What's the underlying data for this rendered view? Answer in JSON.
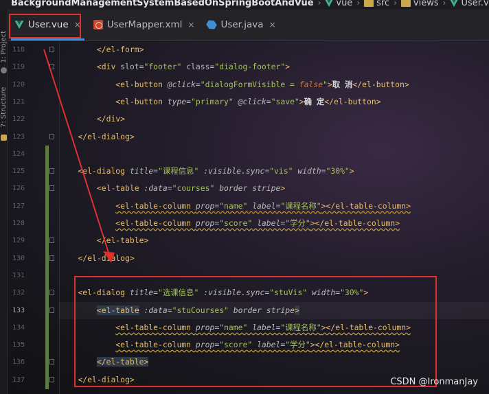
{
  "breadcrumb": {
    "project": "BackgroundManagementSystemBasedOnSpringBootAndVue",
    "items": [
      "vue",
      "src",
      "views",
      "User.vue"
    ]
  },
  "tabs": [
    {
      "label": "User.vue",
      "active": true,
      "icon": "vue-icon"
    },
    {
      "label": "UserMapper.xml",
      "active": false,
      "icon": "xml-mapper-icon"
    },
    {
      "label": "User.java",
      "active": false,
      "icon": "java-class-icon"
    }
  ],
  "close_glyph": "×",
  "toolstrip": {
    "project_label": "1: Project",
    "structure_label": "7: Structure"
  },
  "lines": [
    {
      "num": "118",
      "tokens": [
        [
          "p",
          "        "
        ],
        [
          "t",
          "</el-form>"
        ]
      ]
    },
    {
      "num": "119",
      "tokens": [
        [
          "p",
          "        "
        ],
        [
          "t",
          "<div "
        ],
        [
          "ak",
          "slot"
        ],
        [
          "p",
          "="
        ],
        [
          "s",
          "\"footer\""
        ],
        [
          "p",
          " "
        ],
        [
          "ak",
          "class"
        ],
        [
          "p",
          "="
        ],
        [
          "s",
          "\"dialog-footer\""
        ],
        [
          "t",
          ">"
        ]
      ]
    },
    {
      "num": "120",
      "tokens": [
        [
          "p",
          "            "
        ],
        [
          "t",
          "<el-button "
        ],
        [
          "at",
          "@click"
        ],
        [
          "p",
          "="
        ],
        [
          "s",
          "\"dialogFormVisible = "
        ],
        [
          "kw",
          "false"
        ],
        [
          "s",
          "\""
        ],
        [
          "t",
          ">"
        ],
        [
          "cn",
          "取 消"
        ],
        [
          "t",
          "</el-button>"
        ]
      ]
    },
    {
      "num": "121",
      "tokens": [
        [
          "p",
          "            "
        ],
        [
          "t",
          "<el-button "
        ],
        [
          "at",
          "type"
        ],
        [
          "p",
          "="
        ],
        [
          "s",
          "\"primary\""
        ],
        [
          "p",
          " "
        ],
        [
          "at",
          "@click"
        ],
        [
          "p",
          "="
        ],
        [
          "s",
          "\"save\""
        ],
        [
          "t",
          ">"
        ],
        [
          "cn",
          "确 定"
        ],
        [
          "t",
          "</el-button>"
        ]
      ]
    },
    {
      "num": "122",
      "tokens": [
        [
          "p",
          "        "
        ],
        [
          "t",
          "</div>"
        ]
      ]
    },
    {
      "num": "123",
      "tokens": [
        [
          "p",
          "    "
        ],
        [
          "t",
          "</el-dialog>"
        ]
      ]
    },
    {
      "num": "124",
      "tokens": []
    },
    {
      "num": "125",
      "tokens": [
        [
          "p",
          "    "
        ],
        [
          "t",
          "<el-dialog "
        ],
        [
          "at",
          "title"
        ],
        [
          "p",
          "="
        ],
        [
          "s",
          "\"课程信息\""
        ],
        [
          "p",
          " "
        ],
        [
          "at",
          ":visible.sync"
        ],
        [
          "p",
          "="
        ],
        [
          "s",
          "\"vis\""
        ],
        [
          "p",
          " "
        ],
        [
          "at",
          "width"
        ],
        [
          "p",
          "="
        ],
        [
          "s",
          "\"30%\""
        ],
        [
          "t",
          ">"
        ]
      ]
    },
    {
      "num": "126",
      "tokens": [
        [
          "p",
          "        "
        ],
        [
          "t",
          "<el-table "
        ],
        [
          "at",
          ":data"
        ],
        [
          "p",
          "="
        ],
        [
          "s",
          "\"courses\""
        ],
        [
          "p",
          " "
        ],
        [
          "at",
          "border"
        ],
        [
          "p",
          " "
        ],
        [
          "at",
          "stripe"
        ],
        [
          "t",
          ">"
        ]
      ]
    },
    {
      "num": "127",
      "tokens": [
        [
          "p",
          "            "
        ],
        [
          "tu",
          "<el-table-column "
        ],
        [
          "atu",
          "prop"
        ],
        [
          "pu",
          "="
        ],
        [
          "su",
          "\"name\""
        ],
        [
          "pu",
          " "
        ],
        [
          "atu",
          "label"
        ],
        [
          "pu",
          "="
        ],
        [
          "su",
          "\"课程名称\""
        ],
        [
          "tu",
          "></el-table-column>"
        ]
      ]
    },
    {
      "num": "128",
      "tokens": [
        [
          "p",
          "            "
        ],
        [
          "tu",
          "<el-table-column "
        ],
        [
          "atu",
          "prop"
        ],
        [
          "pu",
          "="
        ],
        [
          "su",
          "\"score\""
        ],
        [
          "pu",
          " "
        ],
        [
          "atu",
          "label"
        ],
        [
          "pu",
          "="
        ],
        [
          "su",
          "\"学分\""
        ],
        [
          "tu",
          "></el-table-column>"
        ]
      ]
    },
    {
      "num": "129",
      "tokens": [
        [
          "p",
          "        "
        ],
        [
          "t",
          "</el-table>"
        ]
      ]
    },
    {
      "num": "130",
      "tokens": [
        [
          "p",
          "    "
        ],
        [
          "t",
          "</el-dialog>"
        ]
      ]
    },
    {
      "num": "131",
      "tokens": []
    },
    {
      "num": "132",
      "tokens": [
        [
          "p",
          "    "
        ],
        [
          "t",
          "<el-dialog "
        ],
        [
          "at",
          "title"
        ],
        [
          "p",
          "="
        ],
        [
          "s",
          "\"选课信息\""
        ],
        [
          "p",
          " "
        ],
        [
          "at",
          ":visible.sync"
        ],
        [
          "p",
          "="
        ],
        [
          "s",
          "\"stuVis\""
        ],
        [
          "p",
          " "
        ],
        [
          "at",
          "width"
        ],
        [
          "p",
          "="
        ],
        [
          "s",
          "\"30%\""
        ],
        [
          "t",
          ">"
        ]
      ]
    },
    {
      "num": "133",
      "tokens": [
        [
          "p",
          "        "
        ],
        [
          "th",
          "<el-table"
        ],
        [
          "t",
          " "
        ],
        [
          "at",
          ":data"
        ],
        [
          "p",
          "="
        ],
        [
          "s",
          "\"stuCourses\""
        ],
        [
          "p",
          " "
        ],
        [
          "at",
          "border"
        ],
        [
          "p",
          " "
        ],
        [
          "at",
          "stripe"
        ],
        [
          "th",
          ">"
        ]
      ]
    },
    {
      "num": "134",
      "tokens": [
        [
          "p",
          "            "
        ],
        [
          "tu",
          "<el-table-column "
        ],
        [
          "atu",
          "prop"
        ],
        [
          "pu",
          "="
        ],
        [
          "su",
          "\"name\""
        ],
        [
          "pu",
          " "
        ],
        [
          "atu",
          "label"
        ],
        [
          "pu",
          "="
        ],
        [
          "su",
          "\"课程名称\""
        ],
        [
          "tu",
          "></el-table-column>"
        ]
      ]
    },
    {
      "num": "135",
      "tokens": [
        [
          "p",
          "            "
        ],
        [
          "tu",
          "<el-table-column "
        ],
        [
          "atu",
          "prop"
        ],
        [
          "pu",
          "="
        ],
        [
          "su",
          "\"score\""
        ],
        [
          "pu",
          " "
        ],
        [
          "atu",
          "label"
        ],
        [
          "pu",
          "="
        ],
        [
          "su",
          "\"学分\""
        ],
        [
          "tu",
          "></el-table-column>"
        ]
      ]
    },
    {
      "num": "136",
      "tokens": [
        [
          "p",
          "        "
        ],
        [
          "th",
          "</el-table>"
        ]
      ]
    },
    {
      "num": "137",
      "tokens": [
        [
          "p",
          "    "
        ],
        [
          "t",
          "</el-dialog>"
        ]
      ]
    }
  ],
  "current_line": "133",
  "watermark": "CSDN @IronmanJay",
  "colors": {
    "annotation_red": "#e0312f",
    "tag": "#e8bf6a",
    "string": "#a5c25c",
    "keyword": "#cc7832",
    "vcs_added": "#5d7a43"
  }
}
